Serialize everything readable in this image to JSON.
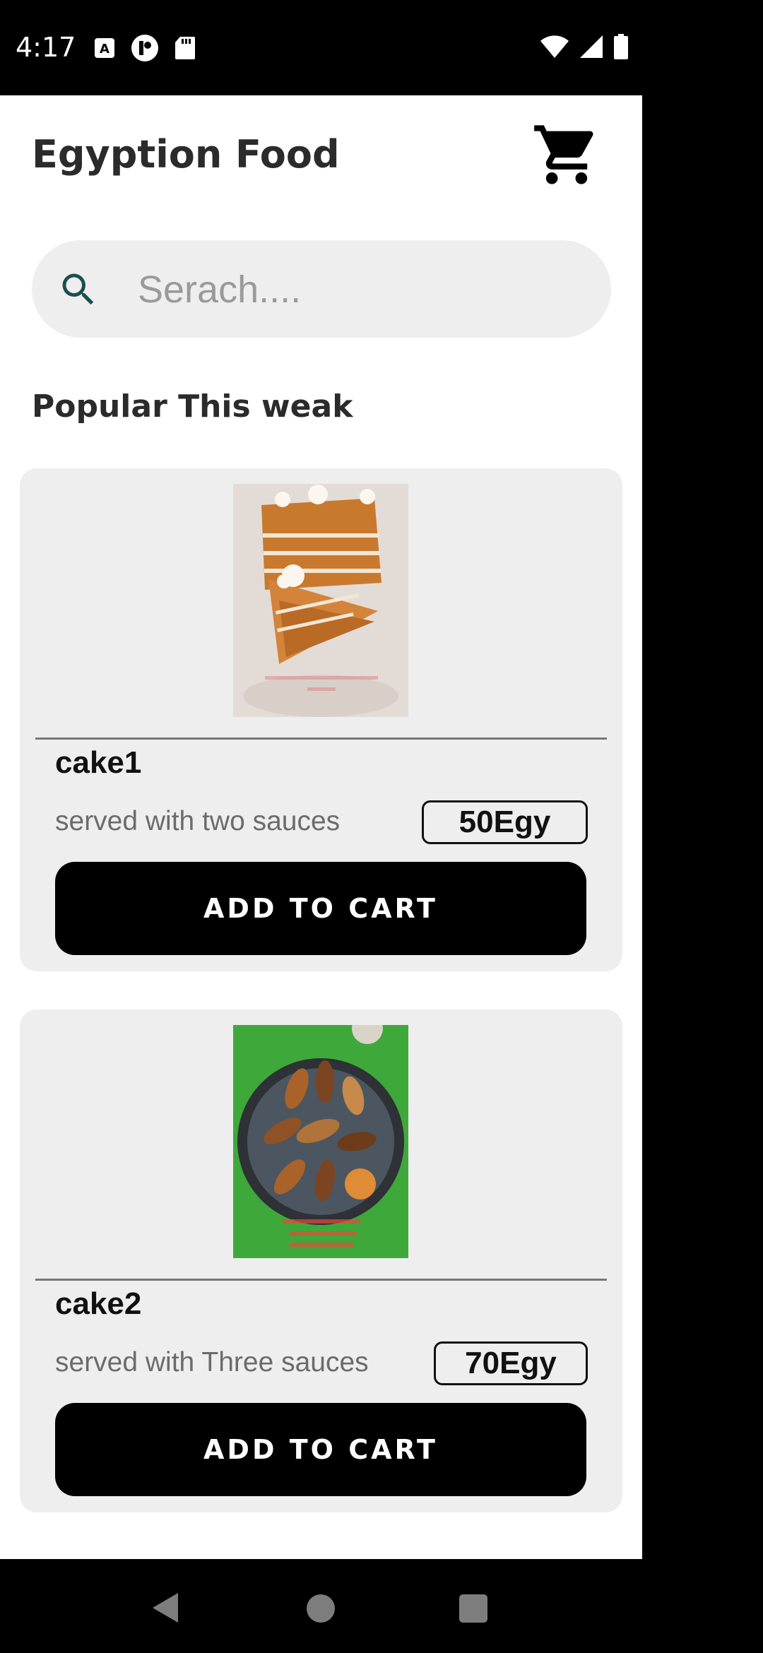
{
  "status_bar": {
    "time": "4:17",
    "left_icons": [
      "a-keyboard-icon",
      "app-notification-icon",
      "sd-card-icon"
    ],
    "right_icons": [
      "wifi-icon",
      "signal-icon",
      "battery-icon"
    ]
  },
  "header": {
    "title": "Egyption Food",
    "cart_icon": "shopping-cart-icon"
  },
  "search": {
    "placeholder": "Serach....",
    "icon": "search-icon"
  },
  "section": {
    "title": "Popular This weak"
  },
  "products": [
    {
      "name": "cake1",
      "description": "served with two sauces",
      "price": "50Egy",
      "button": "ADD TO CART",
      "image": "honey-cake-slice-photo"
    },
    {
      "name": "cake2",
      "description": "served with Three sauces",
      "price": "70Egy",
      "button": "ADD TO CART",
      "image": "eclairs-tray-photo"
    }
  ],
  "colors": {
    "card_bg": "#eeeeee",
    "button_bg": "#000000",
    "search_icon": "#1d4f4f"
  },
  "nav": {
    "back_icon": "back-triangle-icon",
    "home_icon": "home-circle-icon",
    "recents_icon": "recents-square-icon"
  }
}
